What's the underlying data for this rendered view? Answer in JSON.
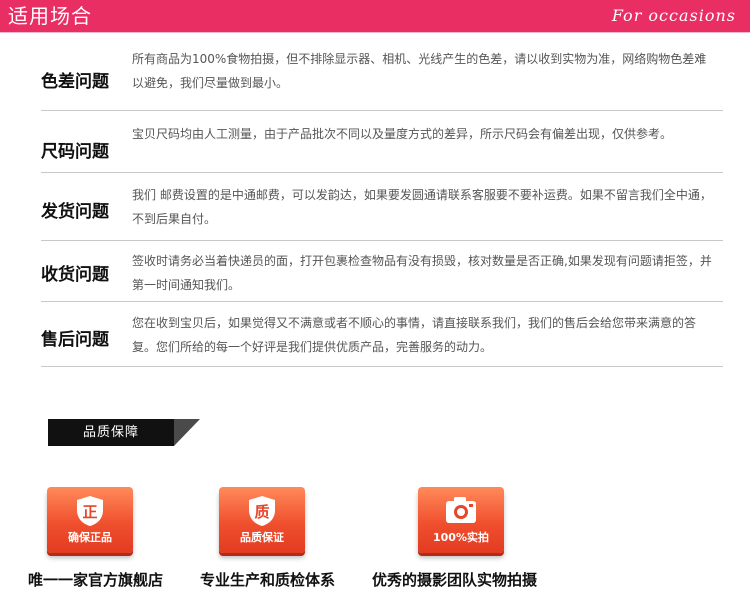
{
  "header": {
    "title": "适用场合",
    "subtitle": "For occasions"
  },
  "faqs": [
    {
      "title": "色差问题",
      "text": "所有商品为100%食物拍摄，但不排除显示器、相机、光线产生的色差，请以收到实物为准，网络购物色差难以避免，我们尽量做到最小。"
    },
    {
      "title": "尺码问题",
      "text": "宝贝尺码均由人工测量，由于产品批次不同以及量度方式的差异，所示尺码会有偏差出现，仅供参考。"
    },
    {
      "title": "发货问题",
      "text": "我们 邮费设置的是中通邮费，可以发韵达，如果要发圆通请联系客服要不要补运费。如果不留言我们全中通，不到后果自付。"
    },
    {
      "title": "收货问题",
      "text": "签收时请务必当着快递员的面，打开包裹检查物品有没有损毁，核对数量是否正确,如果发现有问题请拒签，并第一时间通知我们。"
    },
    {
      "title": "售后问题",
      "text": "您在收到宝贝后，如果觉得又不满意或者不顺心的事情，请直接联系我们，我们的售后会给您带来满意的答复。您们所给的每一个好评是我们提供优质产品，完善服务的动力。"
    }
  ],
  "quality": {
    "badge": "品质保障",
    "features": [
      {
        "icon": "shield-icon",
        "icon_char": "正",
        "icon_label": "确保正品",
        "label": "唯一一家官方旗舰店"
      },
      {
        "icon": "shield-icon",
        "icon_char": "质",
        "icon_label": "品质保证",
        "label": "专业生产和质检体系"
      },
      {
        "icon": "camera-icon",
        "icon_label": "100%实拍",
        "label": "优秀的摄影团队实物拍摄"
      }
    ]
  },
  "colors": {
    "accent": "#e92e64",
    "icon_orange": "#f0502e"
  }
}
